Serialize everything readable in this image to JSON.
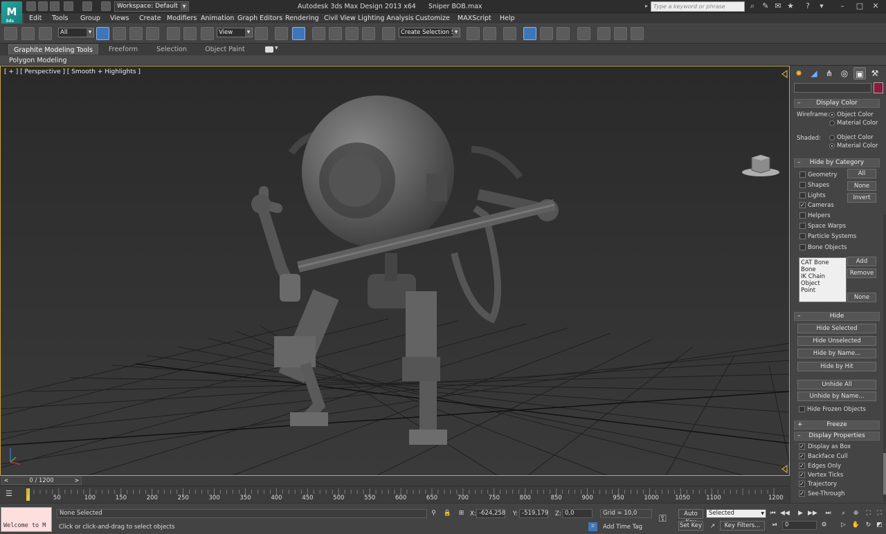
{
  "window": {
    "app_title": "Autodesk 3ds Max Design 2013 x64",
    "file_name": "Sniper BOB.max",
    "workspace_label": "Workspace: Default",
    "search_placeholder": "Type a keyword or phrase",
    "logo_text": "3ds"
  },
  "menus": [
    "Edit",
    "Tools",
    "Group",
    "Views",
    "Create",
    "Modifiers",
    "Animation",
    "Graph Editors",
    "Rendering",
    "Civil View",
    "Lighting Analysis",
    "Customize",
    "MAXScript",
    "Help"
  ],
  "toolbar": {
    "selection_filter": "All",
    "reference_coord": "View",
    "create_selection_set": "Create Selection Se"
  },
  "ribbon": {
    "tabs": [
      "Graphite Modeling Tools",
      "Freeform",
      "Selection",
      "Object Paint"
    ],
    "active_tab": "Graphite Modeling Tools",
    "panel_label": "Polygon Modeling"
  },
  "viewport": {
    "label": "[ + ] [ Perspective ] [ Smooth + Highlights ]"
  },
  "command_panel": {
    "display_color": {
      "title": "Display Color",
      "wireframe_label": "Wireframe:",
      "shaded_label": "Shaded:",
      "options": [
        "Object Color",
        "Material Color"
      ],
      "wireframe_selected": "Object Color",
      "shaded_selected": "Material Color"
    },
    "hide_by_category": {
      "title": "Hide by Category",
      "categories": [
        {
          "label": "Geometry",
          "checked": false
        },
        {
          "label": "Shapes",
          "checked": false
        },
        {
          "label": "Lights",
          "checked": false
        },
        {
          "label": "Cameras",
          "checked": true
        },
        {
          "label": "Helpers",
          "checked": false
        },
        {
          "label": "Space Warps",
          "checked": false
        },
        {
          "label": "Particle Systems",
          "checked": false
        },
        {
          "label": "Bone Objects",
          "checked": false
        }
      ],
      "buttons": {
        "all": "All",
        "none": "None",
        "invert": "Invert",
        "add": "Add",
        "remove": "Remove",
        "none2": "None"
      },
      "list": [
        "CAT Bone",
        "Bone",
        "IK Chain Object",
        "Point"
      ]
    },
    "hide": {
      "title": "Hide",
      "buttons": [
        "Hide Selected",
        "Hide Unselected",
        "Hide by Name...",
        "Hide by Hit",
        "Unhide All",
        "Unhide by Name..."
      ],
      "hide_frozen_label": "Hide Frozen Objects"
    },
    "freeze": {
      "title": "Freeze",
      "sign": "+"
    },
    "display_properties": {
      "title": "Display Properties",
      "items": [
        {
          "label": "Display as Box",
          "checked": true
        },
        {
          "label": "Backface Cull",
          "checked": true
        },
        {
          "label": "Edges Only",
          "checked": true
        },
        {
          "label": "Vertex Ticks",
          "checked": true
        },
        {
          "label": "Trajectory",
          "checked": true
        },
        {
          "label": "See-Through",
          "checked": true
        }
      ]
    },
    "rollout_minus": "–"
  },
  "timeline": {
    "slider_label": "0 / 1200",
    "prev_arrow": "<",
    "next_arrow": ">",
    "ticks": [
      "50",
      "100",
      "150",
      "200",
      "250",
      "300",
      "350",
      "400",
      "450",
      "500",
      "550",
      "600",
      "650",
      "700",
      "750",
      "800",
      "850",
      "900",
      "950",
      "1000",
      "1050",
      "1100",
      "1200"
    ],
    "current_frame": 0,
    "total_frames": 1200
  },
  "status": {
    "welcome": "Welcome to M",
    "selection": "None Selected",
    "prompt": "Click or click-and-drag to select objects",
    "x_label": "X:",
    "x_value": "-624,258",
    "y_label": "Y:",
    "y_value": "-519,179",
    "z_label": "Z:",
    "z_value": "0,0",
    "grid": "Grid = 10,0",
    "add_time_tag": "Add Time Tag",
    "auto_key": "Auto Key",
    "set_key": "Set Key",
    "key_mode": "Selected",
    "key_filters": "Key Filters...",
    "frame_value": "0"
  },
  "colors": {
    "viewport_border": "#cfa642",
    "accent": "#3f76b8",
    "material_swatch": "#8b1a3c"
  }
}
